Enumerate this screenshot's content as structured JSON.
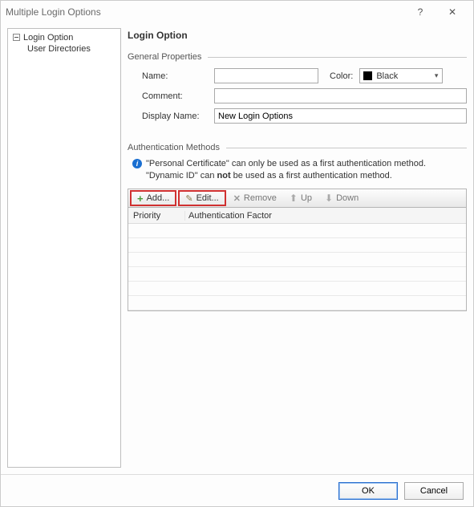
{
  "window": {
    "title": "Multiple Login Options",
    "help_symbol": "?",
    "close_symbol": "✕"
  },
  "tree": {
    "root": "Login Option",
    "child": "User Directories"
  },
  "heading": "Login Option",
  "general": {
    "group_label": "General Properties",
    "name_label": "Name:",
    "name_value": "",
    "color_label": "Color:",
    "color_value": "Black",
    "comment_label": "Comment:",
    "comment_value": "",
    "display_label": "Display Name:",
    "display_value": "New Login Options"
  },
  "auth": {
    "group_label": "Authentication Methods",
    "info_line1_pre": "\"Personal Certificate\" can only be used as a first authentication method.",
    "info_line2_pre": "\"Dynamic ID\" can ",
    "info_line2_bold": "not",
    "info_line2_post": " be used as a first authentication method.",
    "toolbar": {
      "add": "Add...",
      "edit": "Edit...",
      "remove": "Remove",
      "up": "Up",
      "down": "Down"
    },
    "columns": {
      "priority": "Priority",
      "factor": "Authentication Factor"
    }
  },
  "footer": {
    "ok": "OK",
    "cancel": "Cancel"
  }
}
